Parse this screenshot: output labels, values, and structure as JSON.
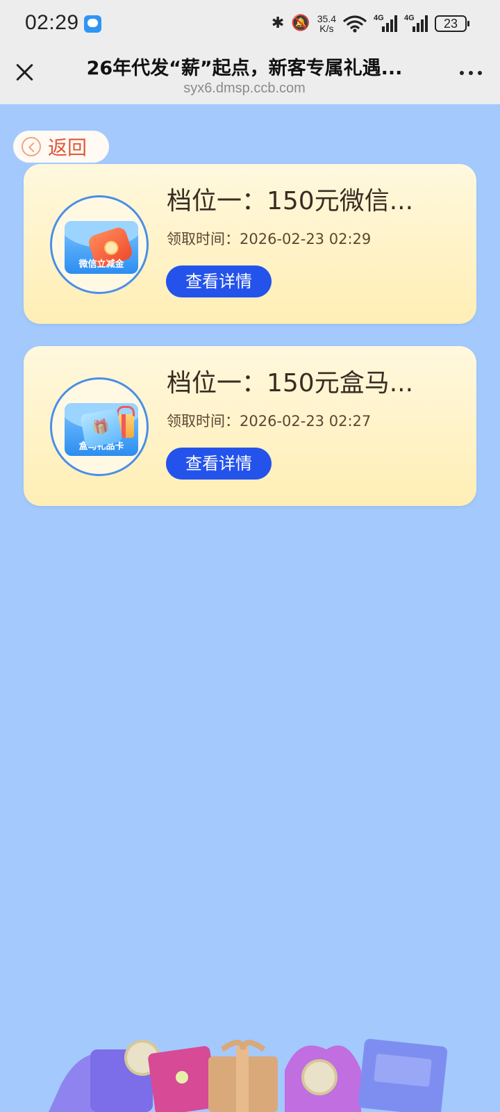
{
  "status_bar": {
    "time": "02:29",
    "net_speed_value": "35.4",
    "net_speed_unit": "K/s",
    "sim1_label": "4G",
    "sim2_label": "4G",
    "battery": "23"
  },
  "browser": {
    "title": "26年代发“薪”起点，新客专属礼遇...",
    "url": "syx6.dmsp.ccb.com"
  },
  "back": {
    "label": "返回"
  },
  "records": [
    {
      "title": "档位一：150元微信...",
      "time": "领取时间：2026-02-23 02:29",
      "button": "查看详情",
      "badge": "微信立减金",
      "icon": "wallet-icon"
    },
    {
      "title": "档位一：150元盒马...",
      "time": "领取时间：2026-02-23 02:27",
      "button": "查看详情",
      "badge": "盒马礼品卡",
      "icon": "gift-card-icon"
    }
  ],
  "colors": {
    "page_bg": "#a4c9fd",
    "card_bg": "#fff3c8",
    "button": "#2453eb",
    "back_text": "#e0563b"
  }
}
